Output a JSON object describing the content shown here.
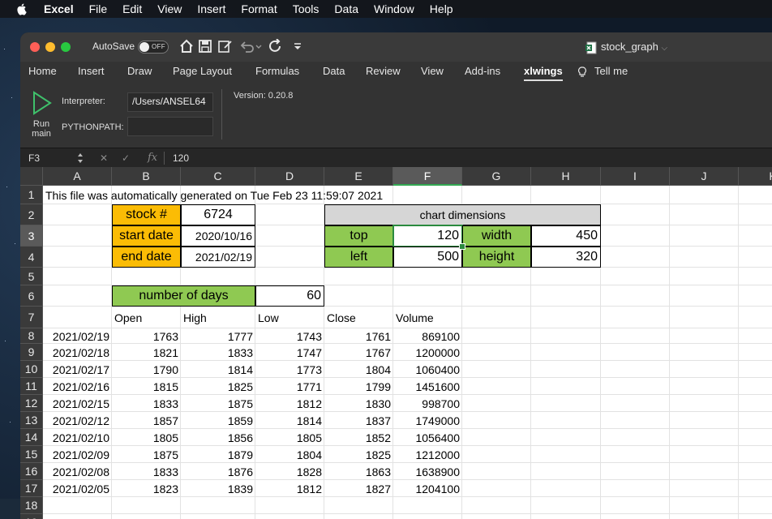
{
  "menubar": {
    "app": "Excel",
    "items": [
      "File",
      "Edit",
      "View",
      "Insert",
      "Format",
      "Tools",
      "Data",
      "Window",
      "Help"
    ]
  },
  "titlebar": {
    "autosave_label": "AutoSave",
    "autosave_state": "OFF",
    "doc_title": "stock_graph"
  },
  "ribbon_tabs": [
    "Home",
    "Insert",
    "Draw",
    "Page Layout",
    "Formulas",
    "Data",
    "Review",
    "View",
    "Add-ins",
    "xlwings",
    "Tell me"
  ],
  "active_tab": "xlwings",
  "ribbon": {
    "run_label_1": "Run",
    "run_label_2": "main",
    "interpreter_label": "Interpreter:",
    "interpreter_value": "/Users/ANSEL64",
    "pythonpath_label": "PYTHONPATH:",
    "pythonpath_value": "",
    "version": "Version: 0.20.8"
  },
  "formula_bar": {
    "name_box": "F3",
    "fx": "fx",
    "value": "120"
  },
  "columns": [
    "A",
    "B",
    "C",
    "D",
    "E",
    "F",
    "G",
    "H",
    "I",
    "J",
    "K"
  ],
  "selected_column": "F",
  "selected_row": "3",
  "sheet": {
    "a1": "This file was automatically generated on Tue Feb 23 11:59:07 2021",
    "stock_label": "stock #",
    "stock_value": "6724",
    "start_label": "start date",
    "start_value": "2020/10/16",
    "end_label": "end date",
    "end_value": "2021/02/19",
    "chart_dims_title": "chart dimensions",
    "top_label": "top",
    "top_value": "120",
    "width_label": "width",
    "width_value": "450",
    "left_label": "left",
    "left_value": "500",
    "height_label": "height",
    "height_value": "320",
    "days_label": "number of days",
    "days_value": "60",
    "headers": [
      "Open",
      "High",
      "Low",
      "Close",
      "Volume"
    ],
    "rows": [
      {
        "row": "8",
        "date": "2021/02/19",
        "open": "1763",
        "high": "1777",
        "low": "1743",
        "close": "1761",
        "volume": "869100"
      },
      {
        "row": "9",
        "date": "2021/02/18",
        "open": "1821",
        "high": "1833",
        "low": "1747",
        "close": "1767",
        "volume": "1200000"
      },
      {
        "row": "10",
        "date": "2021/02/17",
        "open": "1790",
        "high": "1814",
        "low": "1773",
        "close": "1804",
        "volume": "1060400"
      },
      {
        "row": "11",
        "date": "2021/02/16",
        "open": "1815",
        "high": "1825",
        "low": "1771",
        "close": "1799",
        "volume": "1451600"
      },
      {
        "row": "12",
        "date": "2021/02/15",
        "open": "1833",
        "high": "1875",
        "low": "1812",
        "close": "1830",
        "volume": "998700"
      },
      {
        "row": "13",
        "date": "2021/02/12",
        "open": "1857",
        "high": "1859",
        "low": "1814",
        "close": "1837",
        "volume": "1749000"
      },
      {
        "row": "14",
        "date": "2021/02/10",
        "open": "1805",
        "high": "1856",
        "low": "1805",
        "close": "1852",
        "volume": "1056400"
      },
      {
        "row": "15",
        "date": "2021/02/09",
        "open": "1875",
        "high": "1879",
        "low": "1804",
        "close": "1825",
        "volume": "1212000"
      },
      {
        "row": "16",
        "date": "2021/02/08",
        "open": "1833",
        "high": "1876",
        "low": "1828",
        "close": "1863",
        "volume": "1638900"
      },
      {
        "row": "17",
        "date": "2021/02/05",
        "open": "1823",
        "high": "1839",
        "low": "1812",
        "close": "1827",
        "volume": "1204100"
      }
    ]
  },
  "colors": {
    "orange": "#fbbc05",
    "green": "#8fc952",
    "grey": "#d6d6d6",
    "selection": "#2b8a3e"
  }
}
